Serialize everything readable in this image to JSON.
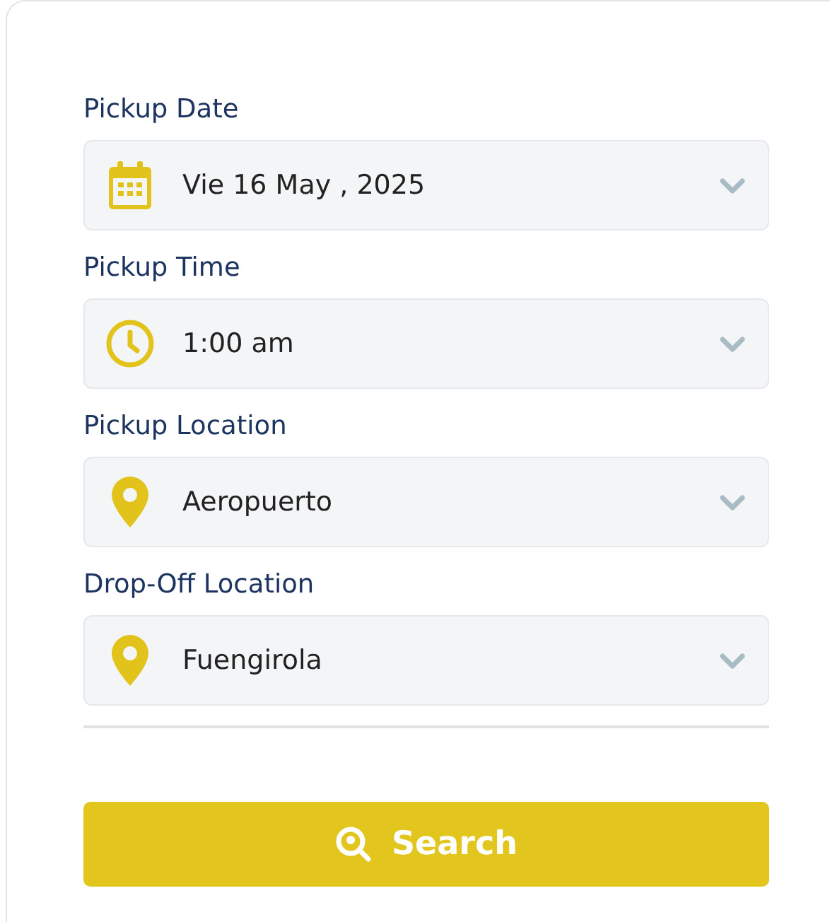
{
  "fields": [
    {
      "label": "Pickup Date",
      "kind": "date",
      "value": "Vie 16 May , 2025"
    },
    {
      "label": "Pickup Time",
      "kind": "time",
      "value": "1:00 am"
    },
    {
      "label": "Pickup Location",
      "kind": "location",
      "value": "Aeropuerto"
    },
    {
      "label": "Drop-Off Location",
      "kind": "location",
      "value": "Fuengirola"
    }
  ],
  "search_button": {
    "label": "Search"
  }
}
